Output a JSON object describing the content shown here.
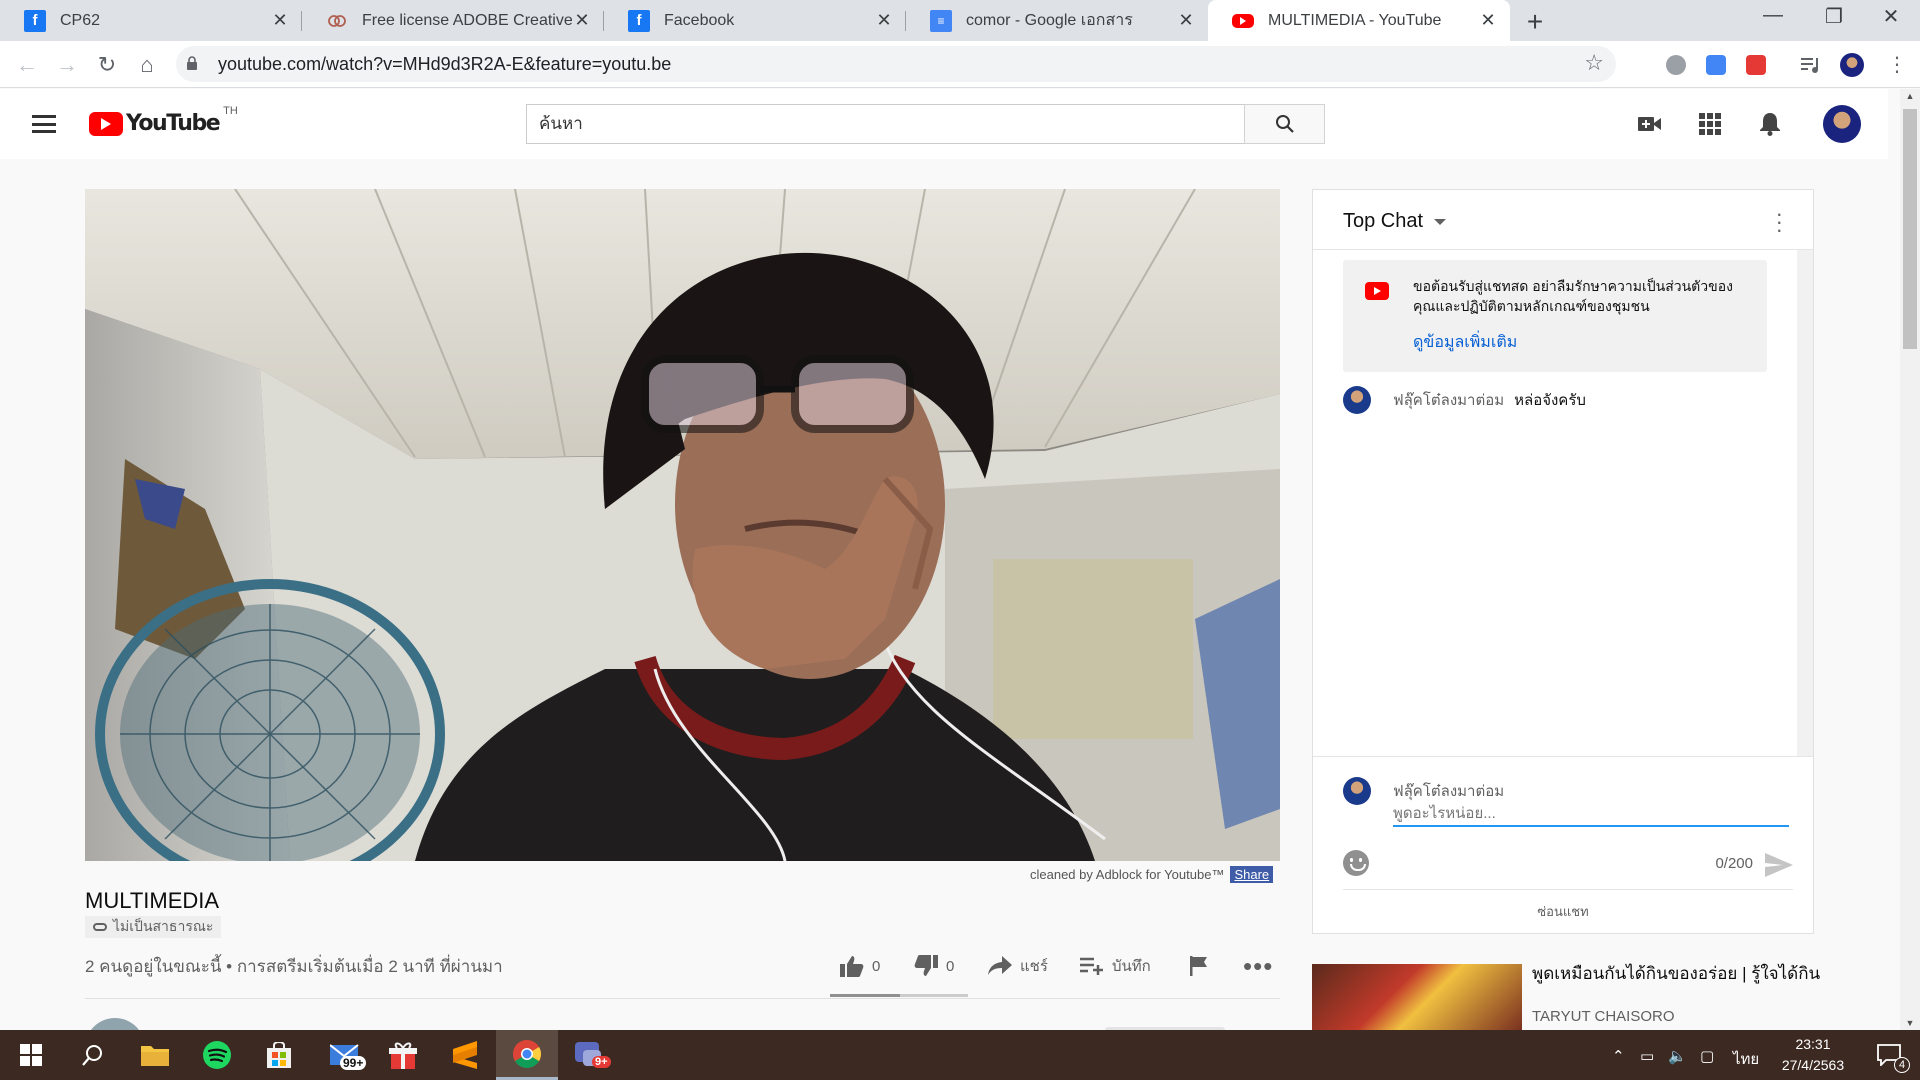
{
  "browser": {
    "tabs": [
      {
        "title": "CP62",
        "icon": "facebook-icon"
      },
      {
        "title": "Free license ADOBE Creative Clou",
        "icon": "creative-cloud-icon"
      },
      {
        "title": "Facebook",
        "icon": "facebook-icon"
      },
      {
        "title": "comor - Google เอกสาร",
        "icon": "google-docs-icon"
      },
      {
        "title": "MULTIMEDIA - YouTube",
        "icon": "youtube-icon"
      }
    ],
    "url": "youtube.com/watch?v=MHd9d3R2A-E&feature=youtu.be"
  },
  "masthead": {
    "logo_text": "YouTube",
    "country_code": "TH",
    "search_placeholder": "ค้นหา"
  },
  "video": {
    "adblock_note": "cleaned by Adblock for Youtube™",
    "share_label": "Share",
    "title": "MULTIMEDIA",
    "privacy_label": "ไม่เป็นสาธารณะ",
    "views_line": "2 คนดูอยู่ในขณะนี้ • การสตรีมเริ่มต้นเมื่อ 2 นาที ที่ผ่านมา",
    "likes": "0",
    "dislikes": "0",
    "share_action": "แชร์",
    "save_action": "บันทึก"
  },
  "chat": {
    "header_label": "Top Chat",
    "welcome_message": "ขอต้อนรับสู่แชทสด อย่าลืมรักษาความเป็นส่วนตัวของคุณและปฏิบัติตามหลักเกณฑ์ของชุมชน",
    "learn_more": "ดูข้อมูลเพิ่มเติม",
    "messages": [
      {
        "author": "ฟลุ๊คโต๋ลงมาต่อม",
        "text": "หล่อจังครับ"
      }
    ],
    "input_name": "ฟลุ๊คโต๋ลงมาต่อม",
    "input_placeholder": "พูดอะไรหน่อย...",
    "char_count": "0/200",
    "hide_chat": "ซ่อนแชท"
  },
  "recommendation": {
    "title": "พูดเหมือนกันได้กินของอร่อย | รู้ใจได้กิน",
    "channel": "TARYUT CHAISORO"
  },
  "taskbar": {
    "store_badge": "99+",
    "app_badge": "9+",
    "language": "ไทย",
    "time": "23:31",
    "date": "27/4/2563",
    "notifications": "4"
  }
}
